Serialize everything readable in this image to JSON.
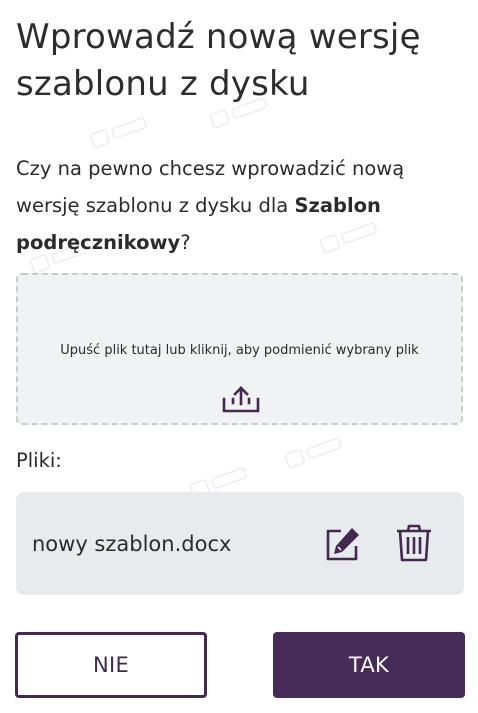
{
  "dialog": {
    "title": "Wprowadź nową wersję szablonu z dysku",
    "question_prefix": "Czy na pewno chcesz wprowadzić nową wersję szablonu z dysku dla ",
    "template_name": "Szablon podręcznikowy",
    "question_suffix": "?"
  },
  "dropzone": {
    "text": "Upuść plik tutaj lub kliknij, aby podmienić wybrany plik",
    "icon": "upload-icon"
  },
  "files": {
    "label": "Pliki:",
    "items": [
      {
        "name": "nowy szablon.docx",
        "edit_icon": "edit-icon",
        "delete_icon": "trash-icon"
      }
    ]
  },
  "buttons": {
    "no_label": "NIE",
    "yes_label": "TAK"
  },
  "colors": {
    "primary": "#472b58",
    "dropzone_bg": "#f1f2f4",
    "file_row_bg": "#e8ebee",
    "dropzone_border": "#c9ccd2"
  }
}
